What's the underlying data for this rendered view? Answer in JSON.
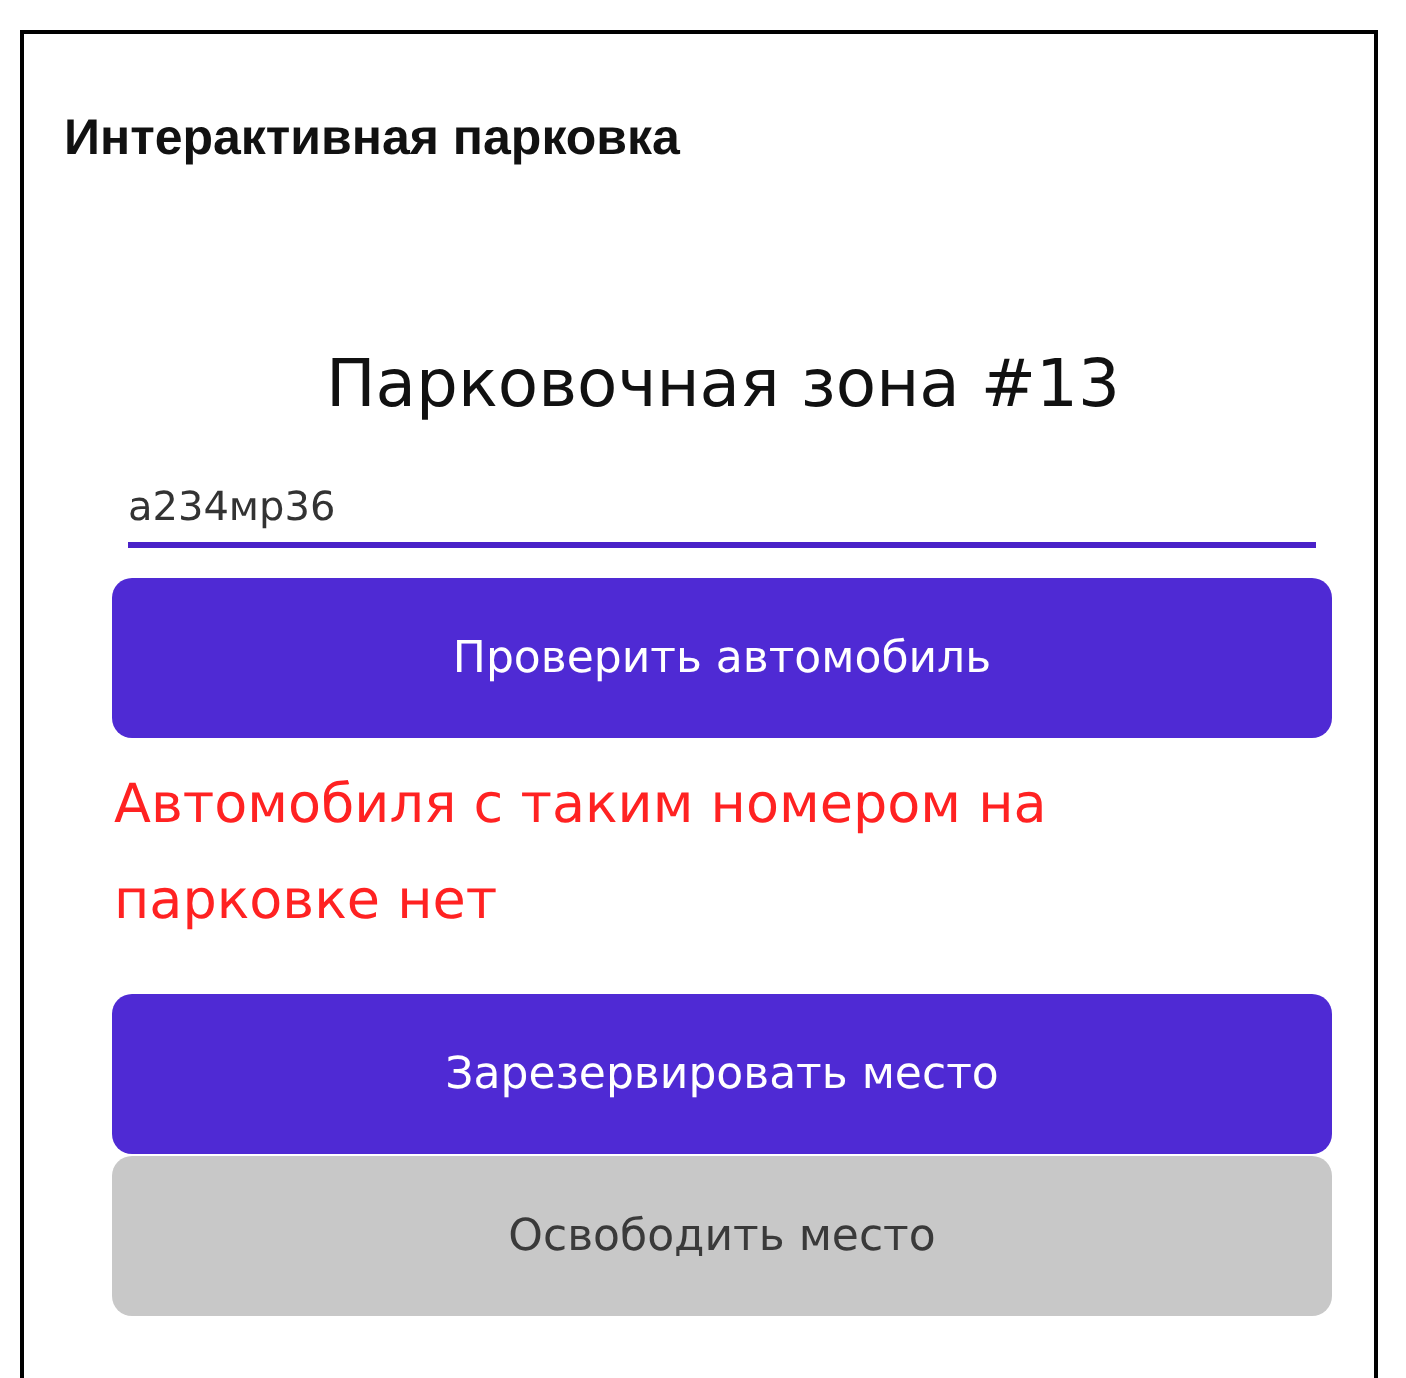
{
  "app_bar": {
    "title": "Интерактивная парковка"
  },
  "zone_title": "Парковочная зона #13",
  "plate_field": {
    "value": "а234мр36",
    "focused": true
  },
  "check_button": {
    "label": "Проверить автомобиль",
    "disabled": false
  },
  "error_message": "Автомобиля с таким номером на парковке нет",
  "actions": [
    {
      "label": "Зарезервировать место",
      "disabled": false
    },
    {
      "label": "Освободить место",
      "disabled": true
    }
  ]
}
